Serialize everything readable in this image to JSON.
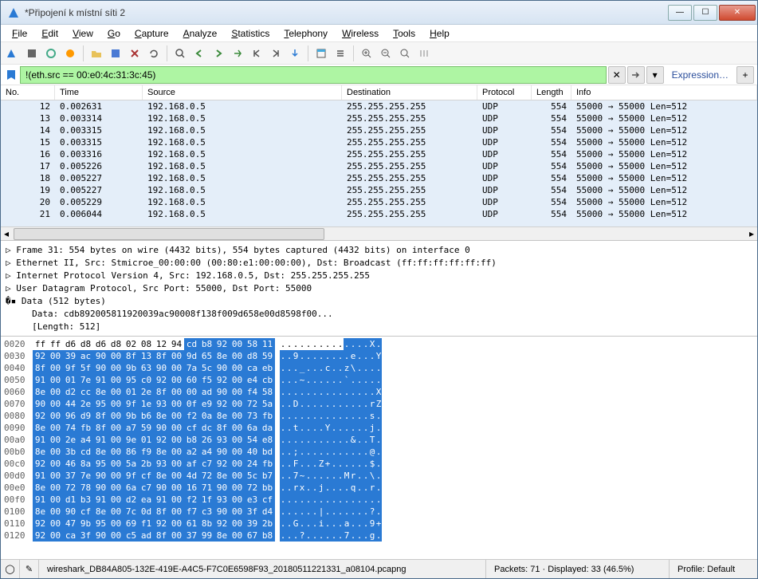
{
  "window": {
    "title": "*Připojení k místní síti 2"
  },
  "menu": [
    "File",
    "Edit",
    "View",
    "Go",
    "Capture",
    "Analyze",
    "Statistics",
    "Telephony",
    "Wireless",
    "Tools",
    "Help"
  ],
  "filter": {
    "value": "!(eth.src == 00:e0:4c:31:3c:45)",
    "expression": "Expression…"
  },
  "columns": {
    "no": "No.",
    "time": "Time",
    "src": "Source",
    "dst": "Destination",
    "proto": "Protocol",
    "len": "Length",
    "info": "Info"
  },
  "packets": [
    {
      "no": "12",
      "time": "0.002631",
      "src": "192.168.0.5",
      "dst": "255.255.255.255",
      "proto": "UDP",
      "len": "554",
      "info": "55000 → 55000 Len=512"
    },
    {
      "no": "13",
      "time": "0.003314",
      "src": "192.168.0.5",
      "dst": "255.255.255.255",
      "proto": "UDP",
      "len": "554",
      "info": "55000 → 55000 Len=512"
    },
    {
      "no": "14",
      "time": "0.003315",
      "src": "192.168.0.5",
      "dst": "255.255.255.255",
      "proto": "UDP",
      "len": "554",
      "info": "55000 → 55000 Len=512"
    },
    {
      "no": "15",
      "time": "0.003315",
      "src": "192.168.0.5",
      "dst": "255.255.255.255",
      "proto": "UDP",
      "len": "554",
      "info": "55000 → 55000 Len=512"
    },
    {
      "no": "16",
      "time": "0.003316",
      "src": "192.168.0.5",
      "dst": "255.255.255.255",
      "proto": "UDP",
      "len": "554",
      "info": "55000 → 55000 Len=512"
    },
    {
      "no": "17",
      "time": "0.005226",
      "src": "192.168.0.5",
      "dst": "255.255.255.255",
      "proto": "UDP",
      "len": "554",
      "info": "55000 → 55000 Len=512"
    },
    {
      "no": "18",
      "time": "0.005227",
      "src": "192.168.0.5",
      "dst": "255.255.255.255",
      "proto": "UDP",
      "len": "554",
      "info": "55000 → 55000 Len=512"
    },
    {
      "no": "19",
      "time": "0.005227",
      "src": "192.168.0.5",
      "dst": "255.255.255.255",
      "proto": "UDP",
      "len": "554",
      "info": "55000 → 55000 Len=512"
    },
    {
      "no": "20",
      "time": "0.005229",
      "src": "192.168.0.5",
      "dst": "255.255.255.255",
      "proto": "UDP",
      "len": "554",
      "info": "55000 → 55000 Len=512"
    },
    {
      "no": "21",
      "time": "0.006044",
      "src": "192.168.0.5",
      "dst": "255.255.255.255",
      "proto": "UDP",
      "len": "554",
      "info": "55000 → 55000 Len=512"
    }
  ],
  "details": [
    "▷ Frame 31: 554 bytes on wire (4432 bits), 554 bytes captured (4432 bits) on interface 0",
    "▷ Ethernet II, Src: Stmicroe_00:00:00 (00:80:e1:00:00:00), Dst: Broadcast (ff:ff:ff:ff:ff:ff)",
    "▷ Internet Protocol Version 4, Src: 192.168.0.5, Dst: 255.255.255.255",
    "▷ User Datagram Protocol, Src Port: 55000, Dst Port: 55000",
    "�▪ Data (512 bytes)",
    "     Data: cdb892005811920039ac90008f138f009d658e00d8598f00...",
    "     [Length: 512]"
  ],
  "hex": [
    {
      "off": "0020",
      "b": [
        "ff",
        "ff",
        "d6",
        "d8",
        "d6",
        "d8",
        "02",
        "08",
        "12",
        "94",
        "cd",
        "b8",
        "92",
        "00",
        "58",
        "11"
      ],
      "a": [
        ".",
        ".",
        ".",
        ".",
        ".",
        ".",
        ".",
        ".",
        ".",
        ".",
        ".",
        ".",
        ".",
        ".",
        "X",
        "."
      ],
      "hstart": 10
    },
    {
      "off": "0030",
      "b": [
        "92",
        "00",
        "39",
        "ac",
        "90",
        "00",
        "8f",
        "13",
        "8f",
        "00",
        "9d",
        "65",
        "8e",
        "00",
        "d8",
        "59"
      ],
      "a": [
        ".",
        ".",
        "9",
        ".",
        ".",
        ".",
        ".",
        ".",
        ".",
        ".",
        ".",
        "e",
        ".",
        ".",
        ".",
        "Y"
      ],
      "hstart": 0
    },
    {
      "off": "0040",
      "b": [
        "8f",
        "00",
        "9f",
        "5f",
        "90",
        "00",
        "9b",
        "63",
        "90",
        "00",
        "7a",
        "5c",
        "90",
        "00",
        "ca",
        "eb"
      ],
      "a": [
        ".",
        ".",
        ".",
        "_",
        ".",
        ".",
        ".",
        "c",
        ".",
        ".",
        "z",
        "\\",
        ".",
        ".",
        ".",
        "."
      ],
      "hstart": 0
    },
    {
      "off": "0050",
      "b": [
        "91",
        "00",
        "01",
        "7e",
        "91",
        "00",
        "95",
        "c0",
        "92",
        "00",
        "60",
        "f5",
        "92",
        "00",
        "e4",
        "cb"
      ],
      "a": [
        ".",
        ".",
        ".",
        "~",
        ".",
        ".",
        ".",
        ".",
        ".",
        ".",
        "`",
        ".",
        ".",
        ".",
        ".",
        "."
      ],
      "hstart": 0
    },
    {
      "off": "0060",
      "b": [
        "8e",
        "00",
        "d2",
        "cc",
        "8e",
        "00",
        "01",
        "2e",
        "8f",
        "00",
        "00",
        "ad",
        "90",
        "00",
        "f4",
        "58"
      ],
      "a": [
        ".",
        ".",
        ".",
        ".",
        ".",
        ".",
        ".",
        ".",
        ".",
        ".",
        ".",
        ".",
        ".",
        ".",
        ".",
        "X"
      ],
      "hstart": 0
    },
    {
      "off": "0070",
      "b": [
        "90",
        "00",
        "44",
        "2e",
        "95",
        "00",
        "9f",
        "1e",
        "93",
        "00",
        "0f",
        "e9",
        "92",
        "00",
        "72",
        "5a"
      ],
      "a": [
        ".",
        ".",
        "D",
        ".",
        ".",
        ".",
        ".",
        ".",
        ".",
        ".",
        ".",
        ".",
        ".",
        ".",
        "r",
        "Z"
      ],
      "hstart": 0
    },
    {
      "off": "0080",
      "b": [
        "92",
        "00",
        "96",
        "d9",
        "8f",
        "00",
        "9b",
        "b6",
        "8e",
        "00",
        "f2",
        "0a",
        "8e",
        "00",
        "73",
        "fb"
      ],
      "a": [
        ".",
        ".",
        ".",
        ".",
        ".",
        ".",
        ".",
        ".",
        ".",
        ".",
        ".",
        ".",
        ".",
        ".",
        "s",
        "."
      ],
      "hstart": 0
    },
    {
      "off": "0090",
      "b": [
        "8e",
        "00",
        "74",
        "fb",
        "8f",
        "00",
        "a7",
        "59",
        "90",
        "00",
        "cf",
        "dc",
        "8f",
        "00",
        "6a",
        "da"
      ],
      "a": [
        ".",
        ".",
        "t",
        ".",
        ".",
        ".",
        ".",
        "Y",
        ".",
        ".",
        ".",
        ".",
        ".",
        ".",
        "j",
        "."
      ],
      "hstart": 0
    },
    {
      "off": "00a0",
      "b": [
        "91",
        "00",
        "2e",
        "a4",
        "91",
        "00",
        "9e",
        "01",
        "92",
        "00",
        "b8",
        "26",
        "93",
        "00",
        "54",
        "e8"
      ],
      "a": [
        ".",
        ".",
        ".",
        ".",
        ".",
        ".",
        ".",
        ".",
        ".",
        ".",
        ".",
        "&",
        ".",
        ".",
        "T",
        "."
      ],
      "hstart": 0
    },
    {
      "off": "00b0",
      "b": [
        "8e",
        "00",
        "3b",
        "cd",
        "8e",
        "00",
        "86",
        "f9",
        "8e",
        "00",
        "a2",
        "a4",
        "90",
        "00",
        "40",
        "bd"
      ],
      "a": [
        ".",
        ".",
        ";",
        ".",
        ".",
        ".",
        ".",
        ".",
        ".",
        ".",
        ".",
        ".",
        ".",
        ".",
        "@",
        "."
      ],
      "hstart": 0
    },
    {
      "off": "00c0",
      "b": [
        "92",
        "00",
        "46",
        "8a",
        "95",
        "00",
        "5a",
        "2b",
        "93",
        "00",
        "af",
        "c7",
        "92",
        "00",
        "24",
        "fb"
      ],
      "a": [
        ".",
        ".",
        "F",
        ".",
        ".",
        ".",
        "Z",
        "+",
        ".",
        ".",
        ".",
        ".",
        ".",
        ".",
        "$",
        "."
      ],
      "hstart": 0
    },
    {
      "off": "00d0",
      "b": [
        "91",
        "00",
        "37",
        "7e",
        "90",
        "00",
        "9f",
        "cf",
        "8e",
        "00",
        "4d",
        "72",
        "8e",
        "00",
        "5c",
        "b7"
      ],
      "a": [
        ".",
        ".",
        "7",
        "~",
        ".",
        ".",
        ".",
        ".",
        ".",
        ".",
        "M",
        "r",
        ".",
        ".",
        "\\",
        "."
      ],
      "hstart": 0
    },
    {
      "off": "00e0",
      "b": [
        "8e",
        "00",
        "72",
        "78",
        "90",
        "00",
        "6a",
        "c7",
        "90",
        "00",
        "16",
        "71",
        "90",
        "00",
        "72",
        "bb"
      ],
      "a": [
        ".",
        ".",
        "r",
        "x",
        ".",
        ".",
        "j",
        ".",
        ".",
        ".",
        ".",
        "q",
        ".",
        ".",
        "r",
        "."
      ],
      "hstart": 0
    },
    {
      "off": "00f0",
      "b": [
        "91",
        "00",
        "d1",
        "b3",
        "91",
        "00",
        "d2",
        "ea",
        "91",
        "00",
        "f2",
        "1f",
        "93",
        "00",
        "e3",
        "cf"
      ],
      "a": [
        ".",
        ".",
        ".",
        ".",
        ".",
        ".",
        ".",
        ".",
        ".",
        ".",
        ".",
        ".",
        ".",
        ".",
        ".",
        "."
      ],
      "hstart": 0
    },
    {
      "off": "0100",
      "b": [
        "8e",
        "00",
        "90",
        "cf",
        "8e",
        "00",
        "7c",
        "0d",
        "8f",
        "00",
        "f7",
        "c3",
        "90",
        "00",
        "3f",
        "d4"
      ],
      "a": [
        ".",
        ".",
        ".",
        ".",
        ".",
        ".",
        "|",
        ".",
        ".",
        ".",
        ".",
        ".",
        ".",
        ".",
        "?",
        "."
      ],
      "hstart": 0
    },
    {
      "off": "0110",
      "b": [
        "92",
        "00",
        "47",
        "9b",
        "95",
        "00",
        "69",
        "f1",
        "92",
        "00",
        "61",
        "8b",
        "92",
        "00",
        "39",
        "2b"
      ],
      "a": [
        ".",
        ".",
        "G",
        ".",
        ".",
        ".",
        "i",
        ".",
        ".",
        ".",
        "a",
        ".",
        ".",
        ".",
        "9",
        "+"
      ],
      "hstart": 0
    },
    {
      "off": "0120",
      "b": [
        "92",
        "00",
        "ca",
        "3f",
        "90",
        "00",
        "c5",
        "ad",
        "8f",
        "00",
        "37",
        "99",
        "8e",
        "00",
        "67",
        "b8"
      ],
      "a": [
        ".",
        ".",
        ".",
        "?",
        ".",
        ".",
        ".",
        ".",
        ".",
        ".",
        "7",
        ".",
        ".",
        ".",
        "g",
        "."
      ],
      "hstart": 0
    }
  ],
  "status": {
    "file": "wireshark_DB84A805-132E-419E-A4C5-F7C0E6598F93_20180511221331_a08104.pcapng",
    "packets": "Packets: 71 · Displayed: 33 (46.5%)",
    "profile": "Profile: Default"
  }
}
